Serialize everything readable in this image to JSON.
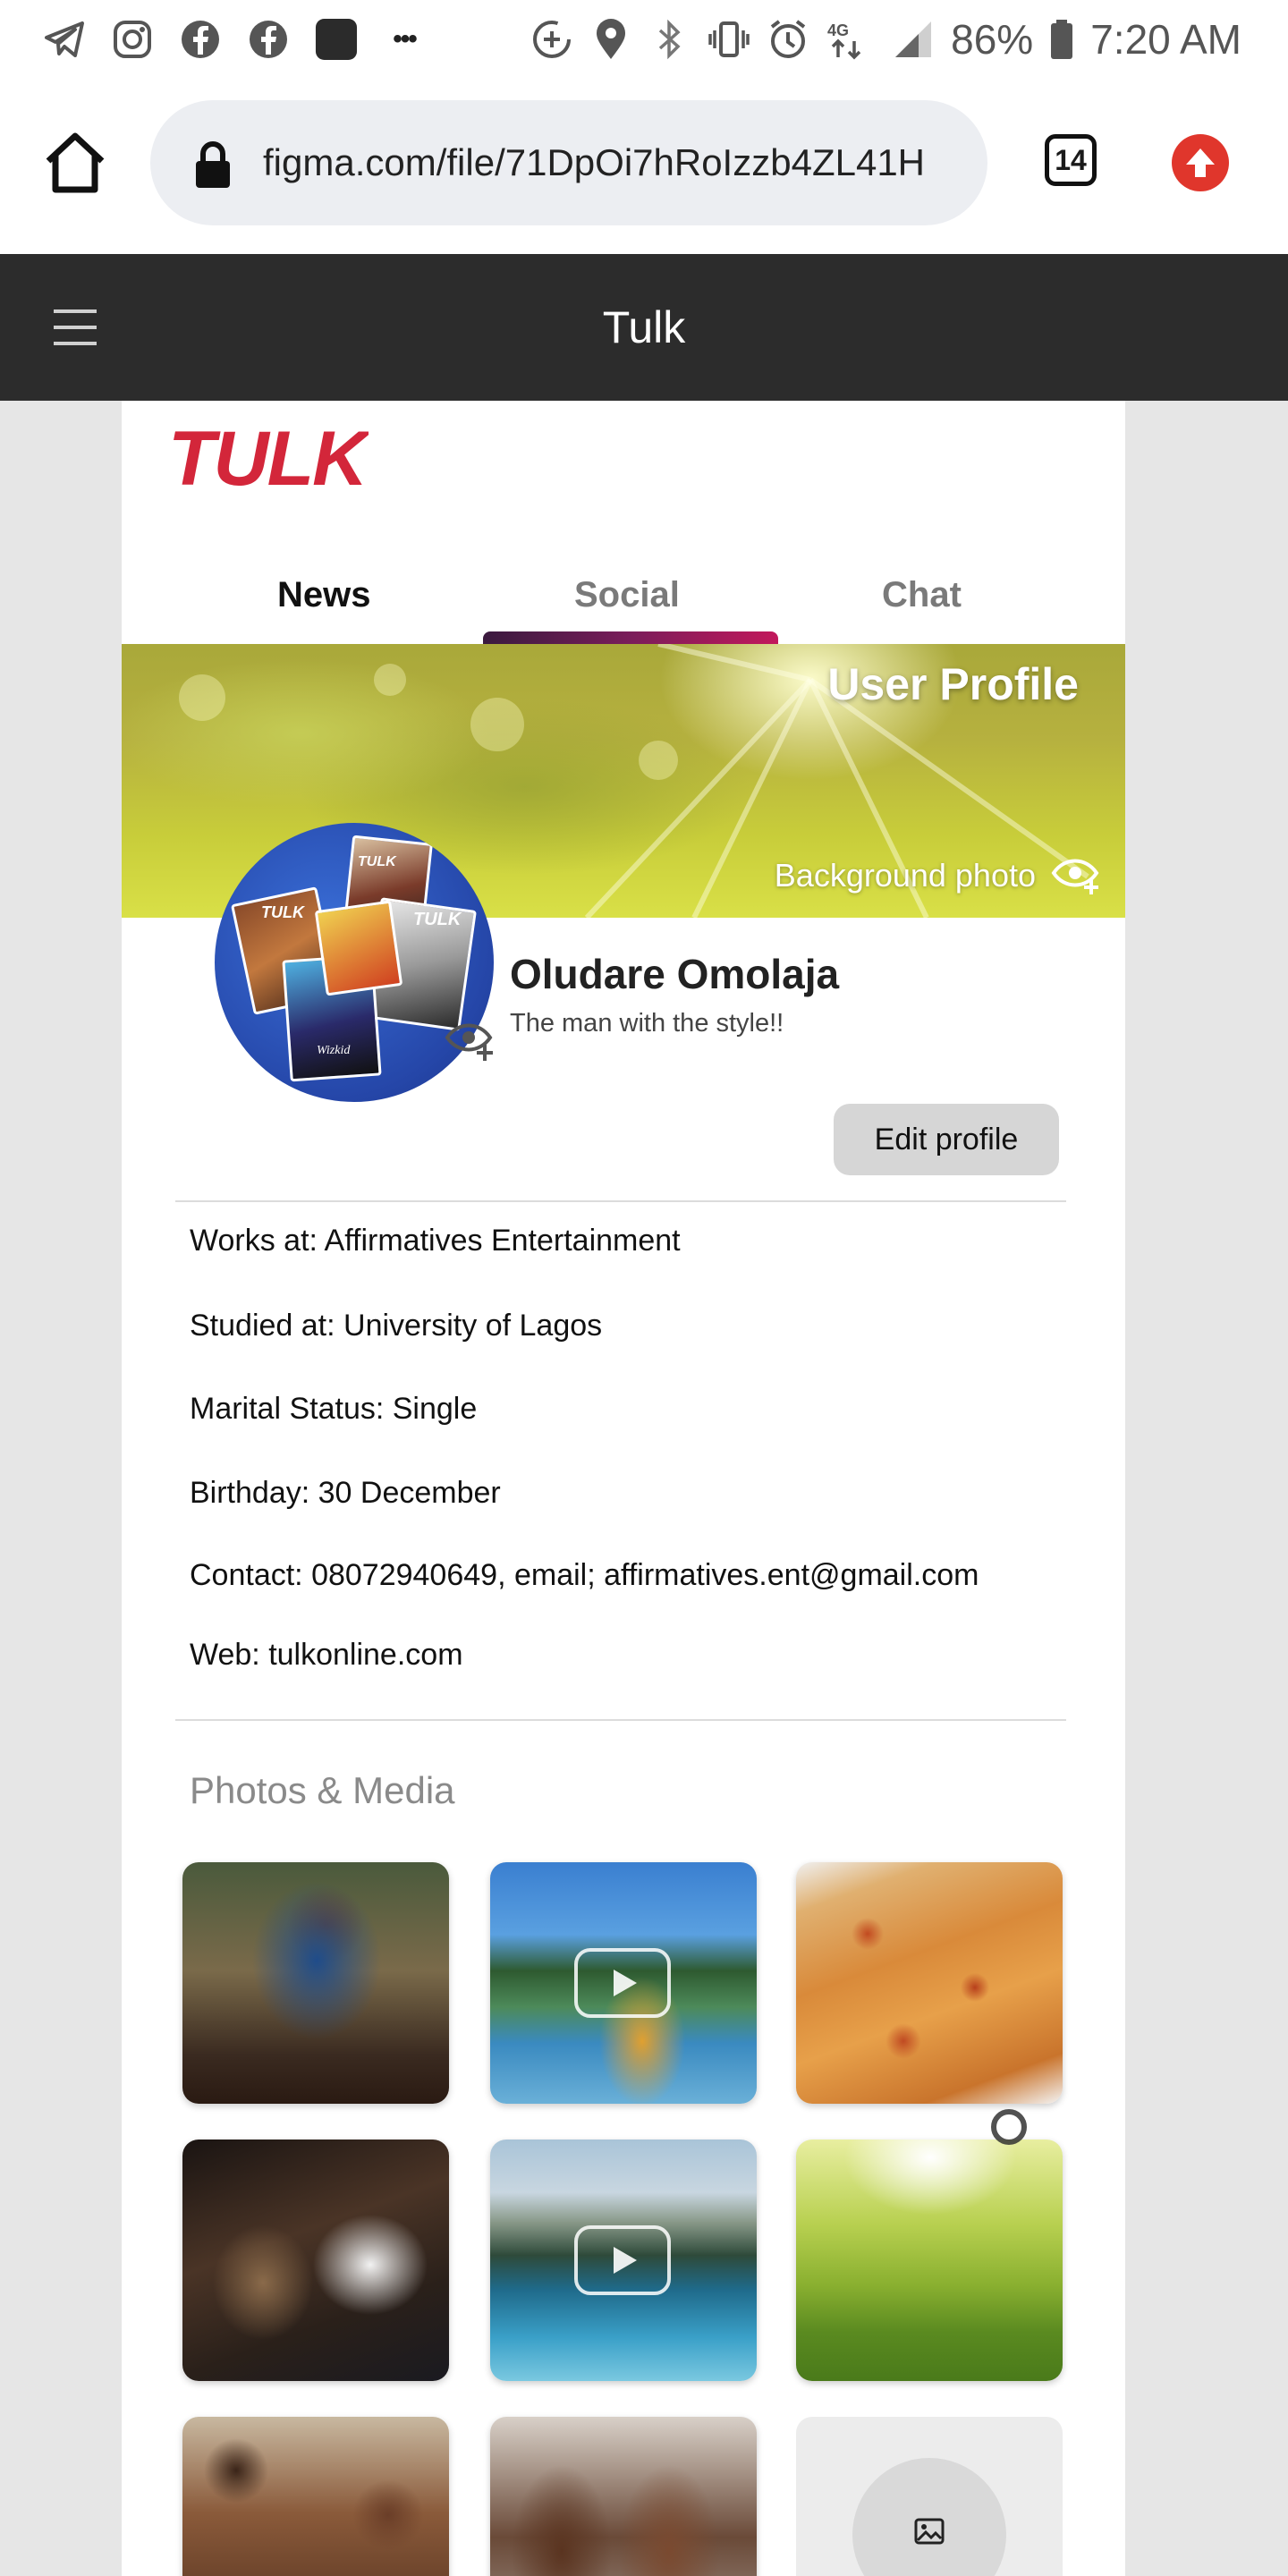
{
  "status_bar": {
    "left_icons": [
      "telegram-icon",
      "instagram-icon",
      "facebook-icon",
      "facebook-icon",
      "app-icon",
      "more-icon"
    ],
    "more_glyph": "•••",
    "battery_percent": "86%",
    "time": "7:20 AM",
    "network": "4G"
  },
  "browser": {
    "url": "figma.com/file/71DpOi7hRoIzzb4ZL41H",
    "tab_count": "14"
  },
  "figma": {
    "title": "Tulk"
  },
  "app": {
    "logo_text": "TULK",
    "tabs": [
      {
        "label": "News",
        "active": false
      },
      {
        "label": "Social",
        "active": true
      },
      {
        "label": "Chat",
        "active": false
      }
    ],
    "cover": {
      "title": "User Profile",
      "background_photo_label": "Background photo"
    },
    "profile": {
      "name": "Oludare Omolaja",
      "tagline": "The man with the style!!",
      "edit_button": "Edit profile"
    },
    "details": [
      "Works at:  Affirmatives Entertainment",
      "Studied at: University of Lagos",
      "Marital Status: Single",
      "Birthday: 30 December",
      "Contact: 08072940649,  email; affirmatives.ent@gmail.com",
      "Web: tulkonline.com"
    ],
    "photos_title": "Photos & Media",
    "avatar_magazine_labels": [
      "TULK",
      "TULK",
      "TULK",
      "Wizkid"
    ],
    "accent_colors": {
      "brand_red": "#d3263a",
      "tab_indicator": "#7a1d5a"
    }
  }
}
